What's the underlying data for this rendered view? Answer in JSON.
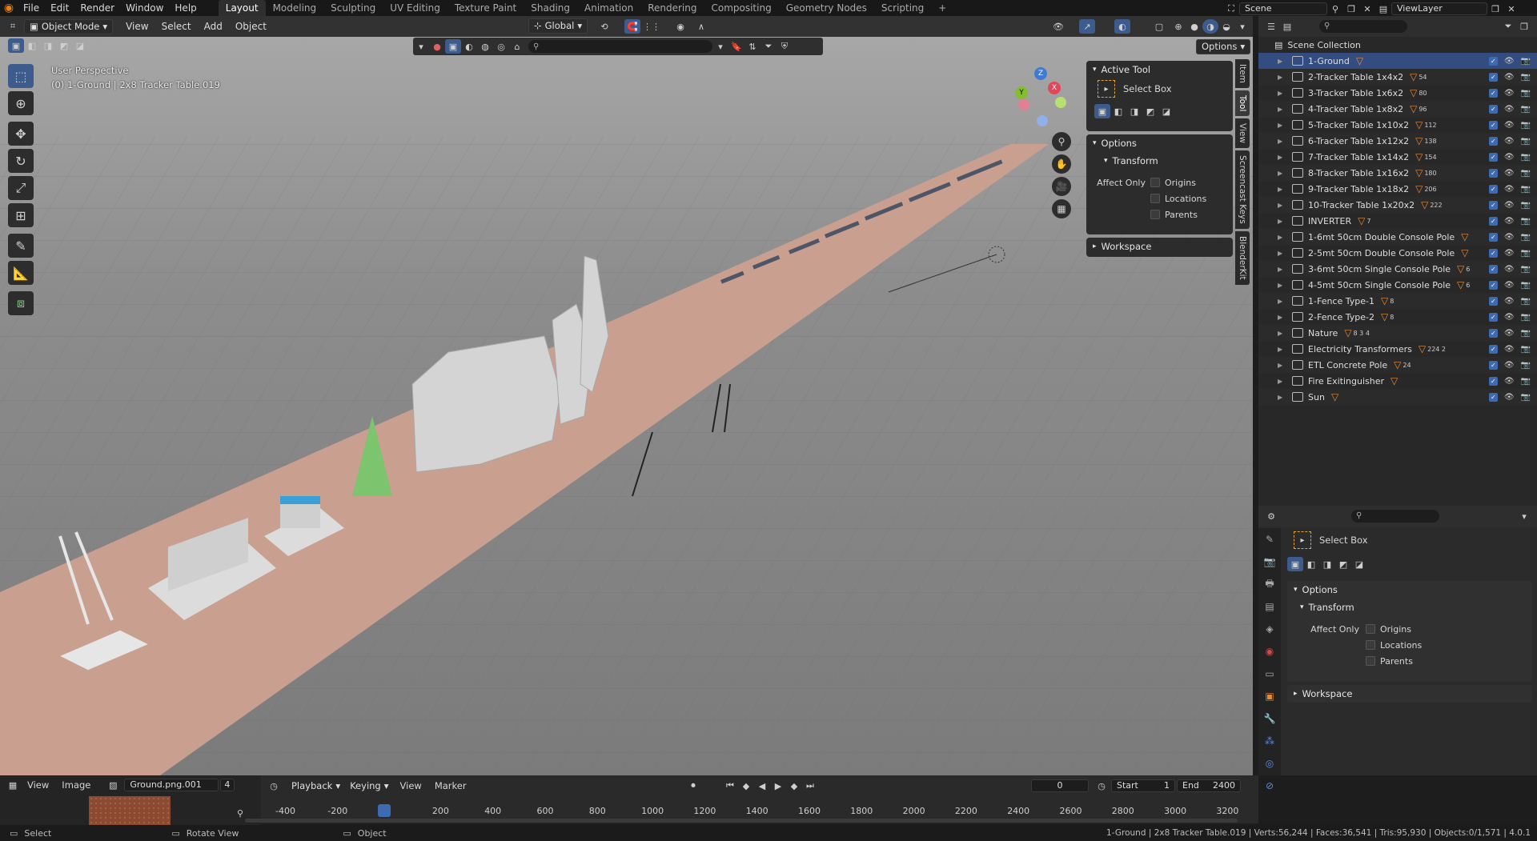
{
  "topbar": {
    "menus": [
      "File",
      "Edit",
      "Render",
      "Window",
      "Help"
    ],
    "workspaces": [
      "Layout",
      "Modeling",
      "Sculpting",
      "UV Editing",
      "Texture Paint",
      "Shading",
      "Animation",
      "Rendering",
      "Compositing",
      "Geometry Nodes",
      "Scripting"
    ],
    "active_workspace": "Layout",
    "scene": "Scene",
    "view_layer": "ViewLayer"
  },
  "viewport": {
    "mode": "Object Mode",
    "menus": [
      "View",
      "Select",
      "Add",
      "Object"
    ],
    "orientation": "Global",
    "options_label": "Options",
    "info_line1": "User Perspective",
    "info_line2": "(0) 1-Ground | 2x8 Tracker Table.019",
    "gizmo": {
      "x": "X",
      "y": "Y",
      "z": "Z"
    },
    "tabs": [
      "Item",
      "Tool",
      "View",
      "Screencast Keys",
      "BlenderKit"
    ],
    "active_tab": "Tool"
  },
  "tool_panel": {
    "active_tool_header": "Active Tool",
    "tool_name": "Select Box",
    "options_header": "Options",
    "transform_header": "Transform",
    "affect_only": "Affect Only",
    "origins": "Origins",
    "locations": "Locations",
    "parents": "Parents",
    "workspace_header": "Workspace"
  },
  "outliner": {
    "root": "Scene Collection",
    "items": [
      {
        "name": "1-Ground",
        "sel": true,
        "badge": ""
      },
      {
        "name": "2-Tracker Table 1x4x2",
        "badge": "54"
      },
      {
        "name": "3-Tracker Table 1x6x2",
        "badge": "80"
      },
      {
        "name": "4-Tracker Table 1x8x2",
        "badge": "96"
      },
      {
        "name": "5-Tracker Table 1x10x2",
        "badge": "112"
      },
      {
        "name": "6-Tracker Table 1x12x2",
        "badge": "138"
      },
      {
        "name": "7-Tracker Table 1x14x2",
        "badge": "154"
      },
      {
        "name": "8-Tracker Table 1x16x2",
        "badge": "180"
      },
      {
        "name": "9-Tracker Table 1x18x2",
        "badge": "206"
      },
      {
        "name": "10-Tracker Table 1x20x2",
        "badge": "222"
      },
      {
        "name": "INVERTER",
        "badge": "7"
      },
      {
        "name": "1-6mt 50cm Double Console Pole",
        "badge": ""
      },
      {
        "name": "2-5mt 50cm Double Console Pole",
        "badge": ""
      },
      {
        "name": "3-6mt 50cm Single Console Pole",
        "badge": "6"
      },
      {
        "name": "4-5mt 50cm Single Console Pole",
        "badge": "6"
      },
      {
        "name": "1-Fence Type-1",
        "badge": "8"
      },
      {
        "name": "2-Fence Type-2",
        "badge": "8"
      },
      {
        "name": "Nature",
        "badge": "8 3 4"
      },
      {
        "name": "Electricity Transformers",
        "badge": "224 2"
      },
      {
        "name": "ETL Concrete Pole",
        "badge": "24"
      },
      {
        "name": "Fire Exitinguisher",
        "badge": ""
      },
      {
        "name": "Sun",
        "badge": ""
      }
    ]
  },
  "properties": {
    "tool_name": "Select Box",
    "options_header": "Options",
    "transform_header": "Transform",
    "affect_only": "Affect Only",
    "origins": "Origins",
    "locations": "Locations",
    "parents": "Parents",
    "workspace_header": "Workspace"
  },
  "image_editor": {
    "menus": [
      "View",
      "Image"
    ],
    "image_name": "Ground.png.001",
    "users": "4"
  },
  "timeline": {
    "menus": [
      "Playback",
      "Keying",
      "View",
      "Marker"
    ],
    "current_frame": "0",
    "start_label": "Start",
    "start": "1",
    "end_label": "End",
    "end": "2400",
    "ticks": [
      "-400",
      "-200",
      "0",
      "200",
      "400",
      "600",
      "800",
      "1000",
      "1200",
      "1400",
      "1600",
      "1800",
      "2000",
      "2200",
      "2400",
      "2600",
      "2800",
      "3000",
      "3200"
    ]
  },
  "statusbar": {
    "select": "Select",
    "rotate": "Rotate View",
    "object": "Object",
    "stats": "1-Ground | 2x8 Tracker Table.019 | Verts:56,244 | Faces:36,541 | Tris:95,930 | Objects:0/1,571 | 4.0.1"
  }
}
